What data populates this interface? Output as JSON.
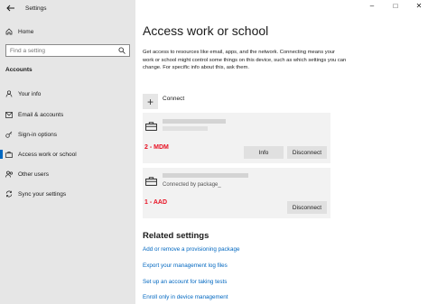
{
  "window": {
    "title": "Settings",
    "controls": [
      "minimize",
      "maximize",
      "close"
    ]
  },
  "sidebar": {
    "home": {
      "label": "Home",
      "icon": "home-icon"
    },
    "search": {
      "placeholder": "Find a setting",
      "icon": "search-icon"
    },
    "section": "Accounts",
    "items": [
      {
        "label": "Your info",
        "icon": "person-icon",
        "active": false
      },
      {
        "label": "Email & accounts",
        "icon": "mail-icon",
        "active": false
      },
      {
        "label": "Sign-in options",
        "icon": "key-icon",
        "active": false
      },
      {
        "label": "Access work or school",
        "icon": "briefcase-icon",
        "active": true
      },
      {
        "label": "Other users",
        "icon": "people-icon",
        "active": false
      },
      {
        "label": "Sync your settings",
        "icon": "sync-icon",
        "active": false
      }
    ]
  },
  "main": {
    "title": "Access work or school",
    "description": "Get access to resources like email, apps, and the network. Connecting means your work or school might control some things on this device, such as which settings you can change. For specific info about this, ask them.",
    "connect": {
      "label": "Connect"
    },
    "accounts": [
      {
        "tag": "2 - MDM",
        "buttons": {
          "info": "Info",
          "disconnect": "Disconnect"
        }
      },
      {
        "subtitle": "Connected by package_",
        "tag": "1 - AAD",
        "buttons": {
          "disconnect": "Disconnect"
        }
      }
    ],
    "related": {
      "heading": "Related settings",
      "links": [
        "Add or remove a provisioning package",
        "Export your management log files",
        "Set up an account for taking tests",
        "Enroll only in device management"
      ]
    }
  },
  "colors": {
    "accent": "#0067c0",
    "annotation": "#e81123",
    "sidebar_bg": "#e6e6e6",
    "card_bg": "#f2f2f2"
  }
}
